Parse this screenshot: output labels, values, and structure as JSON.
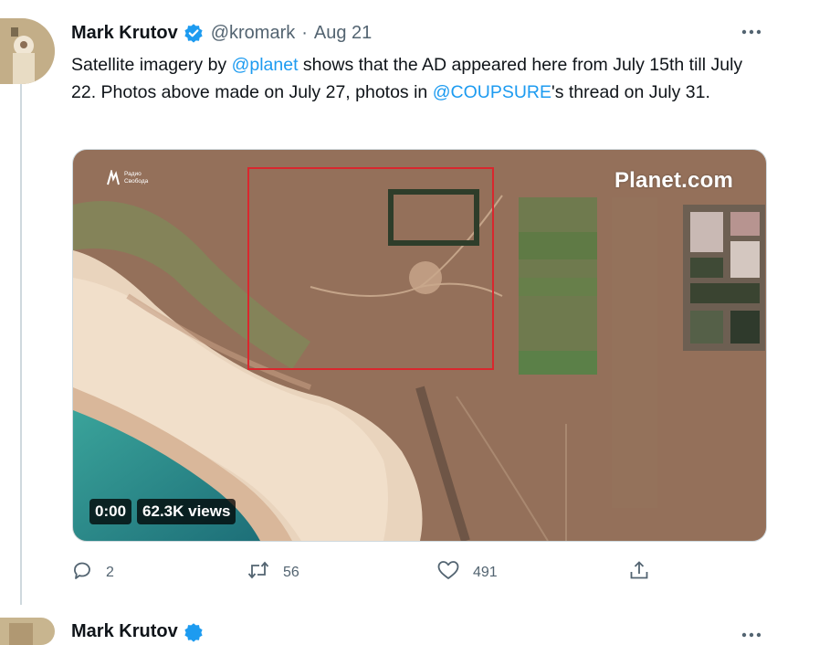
{
  "tweet": {
    "author_name": "Mark Krutov",
    "handle": "@kromark",
    "separator": "·",
    "date": "Aug 21",
    "text_parts": {
      "a": "Satellite imagery by ",
      "mention1": "@planet",
      "b": " shows that the AD appeared here from July 15th till July 22. Photos above made on July 27, photos in ",
      "mention2": "@COUPSURE",
      "c": "'s thread on July 31."
    },
    "video": {
      "watermark": "Planet.com",
      "logo_text_1": "Радио",
      "logo_text_2": "Свобода",
      "time": "0:00",
      "views": "62.3K views"
    },
    "actions": {
      "replies": "2",
      "retweets": "56",
      "likes": "491"
    }
  },
  "next_tweet": {
    "author_name": "Mark Krutov"
  },
  "colors": {
    "accent": "#1d9bf0",
    "secondary_text": "#536471",
    "highlight_box": "#d9272e"
  },
  "icons": [
    "verified-badge-icon",
    "more-icon",
    "reply-icon",
    "retweet-icon",
    "like-icon",
    "share-icon"
  ]
}
